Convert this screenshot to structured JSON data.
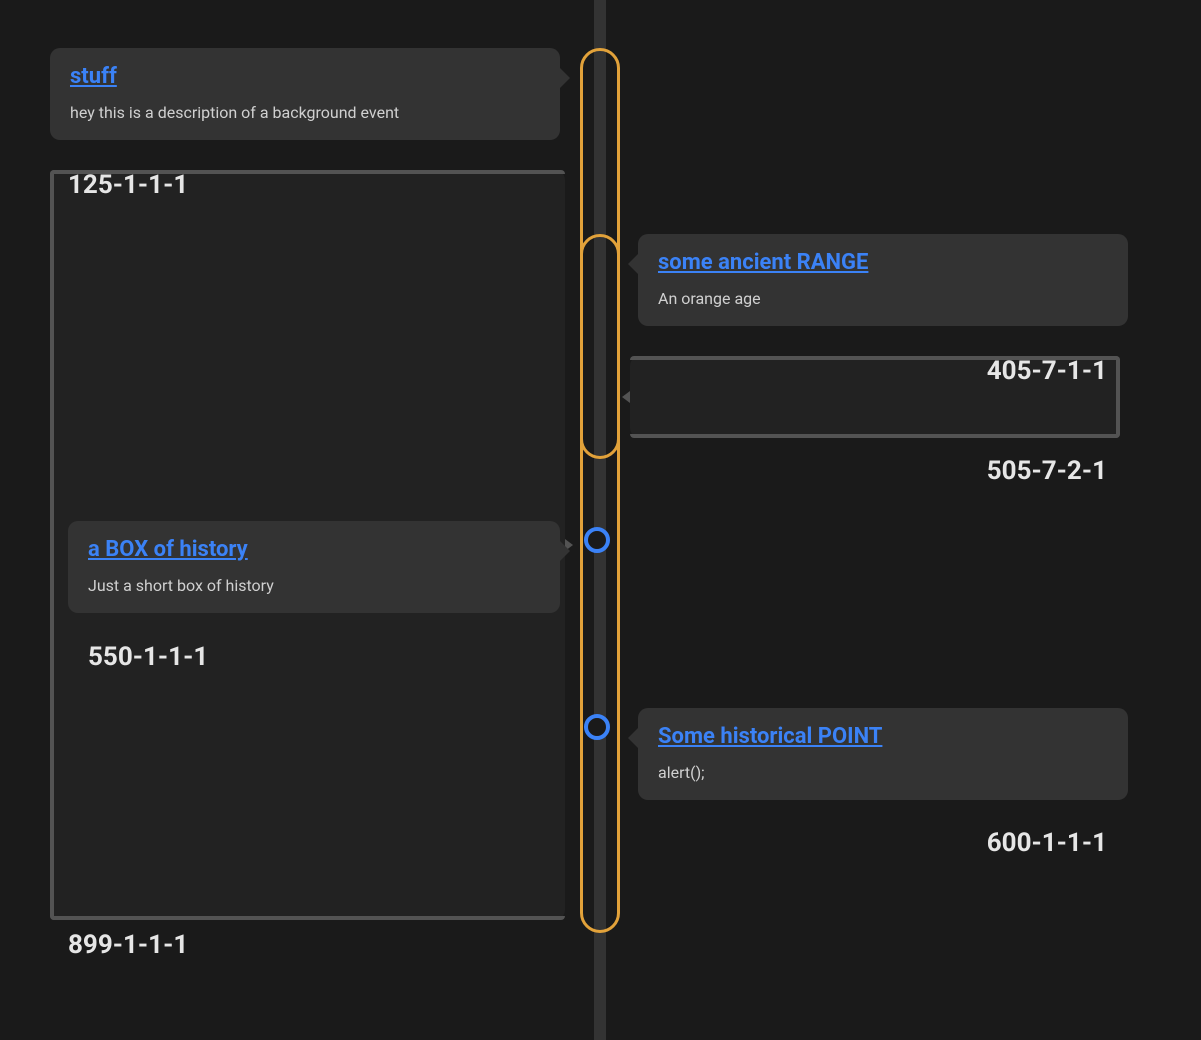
{
  "timeline": {
    "accent_color": "#e2a23a",
    "link_color": "#3b82f6",
    "items": [
      {
        "id": "stuff",
        "side": "left",
        "kind": "range",
        "title": "stuff",
        "description": "hey this is a description of a background event",
        "start_label": "125-1-1-1",
        "end_label": "899-1-1-1"
      },
      {
        "id": "ancient-range",
        "side": "right",
        "kind": "range",
        "title": "some ancient RANGE",
        "description": "An orange age",
        "start_label": "405-7-1-1",
        "end_label": "505-7-2-1"
      },
      {
        "id": "box-history",
        "side": "left",
        "kind": "point",
        "title": "a BOX of history",
        "description": "Just a short box of history",
        "start_label": "550-1-1-1"
      },
      {
        "id": "historical-point",
        "side": "right",
        "kind": "point",
        "title": "Some historical POINT",
        "description": "alert();",
        "start_label": "600-1-1-1"
      }
    ]
  }
}
